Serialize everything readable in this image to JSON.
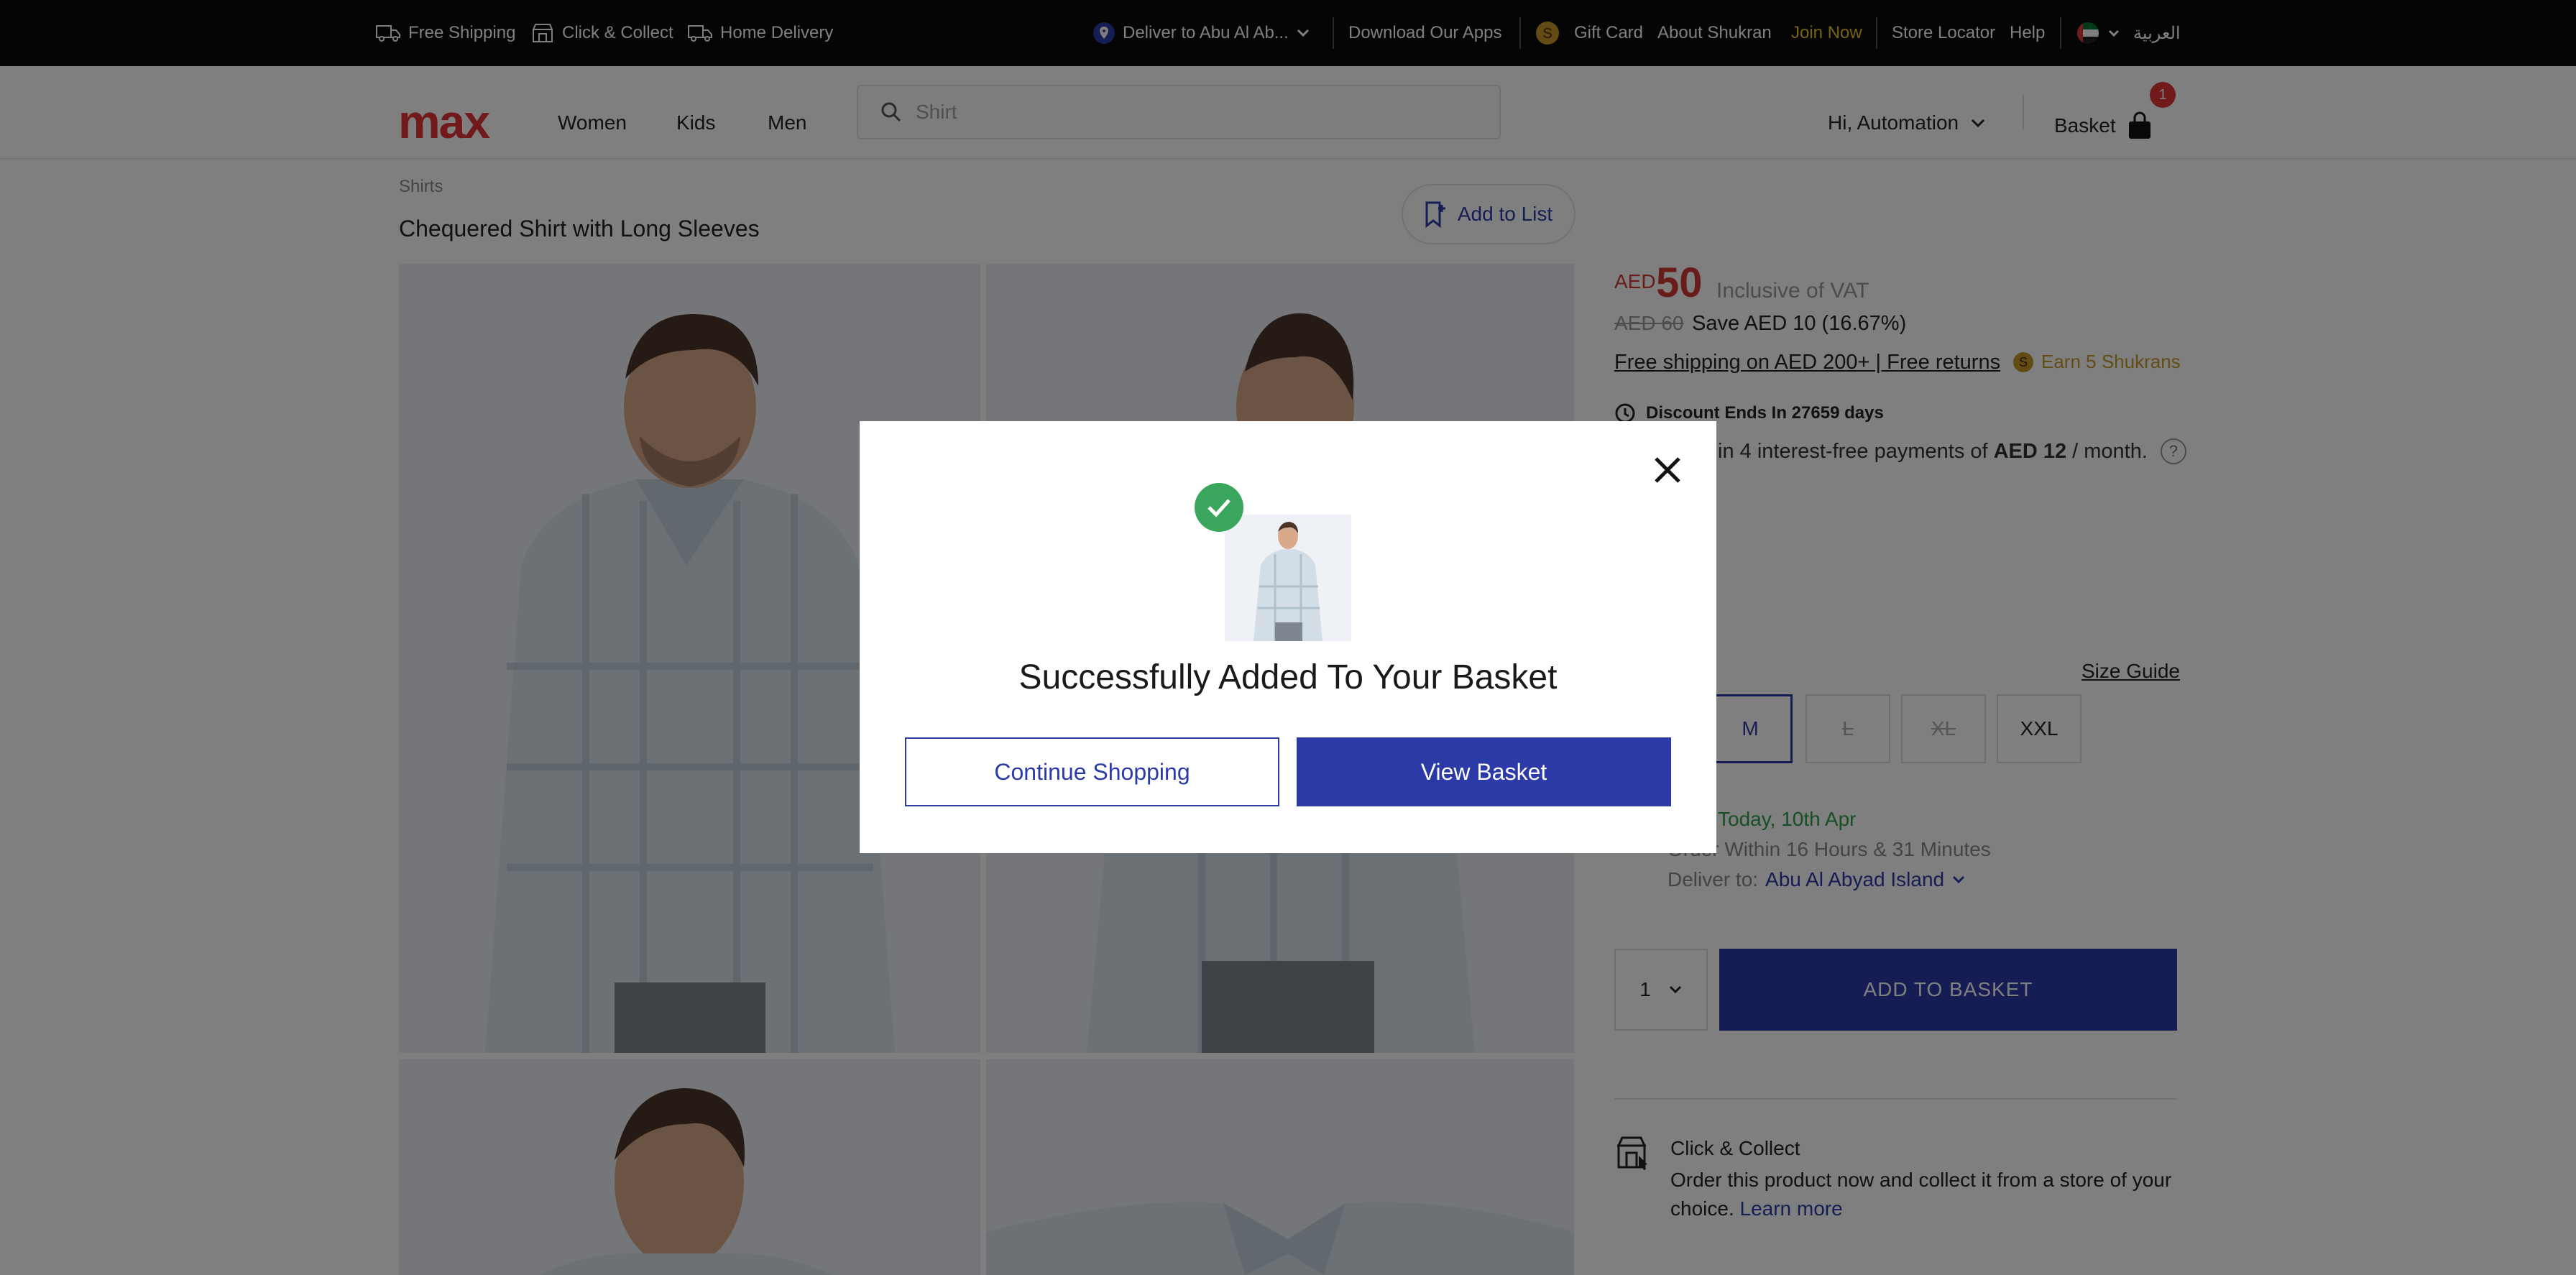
{
  "topbar": {
    "free_shipping": "Free Shipping",
    "click_collect": "Click & Collect",
    "home_delivery": "Home Delivery",
    "deliver_to": "Deliver to Abu Al Ab...",
    "download_apps": "Download Our Apps",
    "gift_card": "Gift Card",
    "about_shukran": "About Shukran",
    "join_now": "Join Now",
    "store_locator": "Store Locator",
    "help": "Help",
    "language": "العربية"
  },
  "header": {
    "logo": "max",
    "nav": [
      "Women",
      "Kids",
      "Men"
    ],
    "search_placeholder": "Shirt",
    "account": "Hi, Automation",
    "basket_label": "Basket",
    "basket_count": "1"
  },
  "product": {
    "breadcrumb": "Shirts",
    "title": "Chequered Shirt with Long Sleeves",
    "add_to_list": "Add to List",
    "currency": "AED",
    "price": "50",
    "vat": "Inclusive of VAT",
    "old_price": "AED 60",
    "save": "Save AED 10 (16.67%)",
    "shipping": "Free shipping on AED 200+ | Free returns",
    "earn": "Earn 5 Shukrans",
    "discount": "Discount Ends In 27659 days",
    "installment_pre": "in 4 interest-free payments of",
    "installment_amount": "AED 12",
    "installment_post": "/ month.",
    "size_guide": "Size Guide",
    "sizes": [
      {
        "label": "M",
        "state": "selected"
      },
      {
        "label": "L",
        "state": "unavailable"
      },
      {
        "label": "XL",
        "state": "unavailable"
      },
      {
        "label": "XXL",
        "state": "available"
      }
    ],
    "delivery_date": "Today, 10th Apr",
    "order_within": "Order Within 16 Hours & 31 Minutes",
    "deliver_to_label": "Deliver to:",
    "deliver_to_value": "Abu Al Abyad Island",
    "quantity": "1",
    "add_to_basket": "ADD TO BASKET",
    "cc_title": "Click & Collect",
    "cc_text": "Order this product now and collect it from a store of your choice.",
    "cc_link": "Learn more"
  },
  "modal": {
    "title": "Successfully Added To Your Basket",
    "continue": "Continue Shopping",
    "view_basket": "View Basket"
  },
  "colors": {
    "brand_blue": "#2c3aa8",
    "price_red": "#d23b34",
    "success_green": "#3aa55c"
  }
}
